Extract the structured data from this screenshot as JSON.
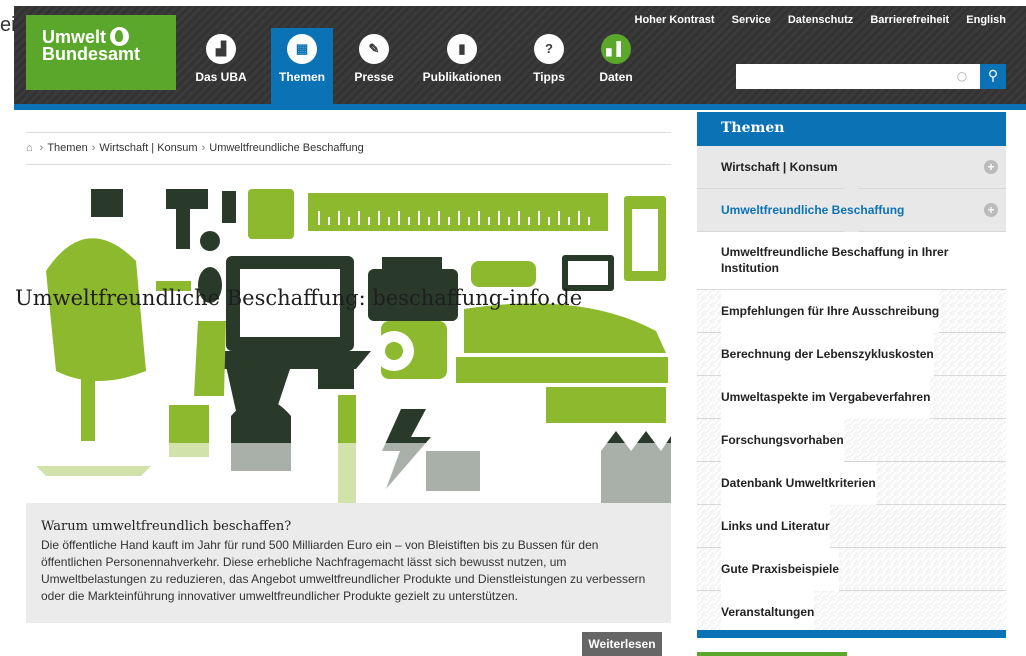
{
  "stray_text": "ei",
  "logo": {
    "line1": "Umwelt",
    "line2": "Bundesamt"
  },
  "top_links": [
    "Hoher Kontrast",
    "Service",
    "Datenschutz",
    "Barrierefreiheit",
    "English"
  ],
  "nav": [
    {
      "label": "Das UBA",
      "icon": "building-icon",
      "active": false
    },
    {
      "label": "Themen",
      "icon": "grid-icon",
      "active": true
    },
    {
      "label": "Presse",
      "icon": "pencil-icon",
      "active": false
    },
    {
      "label": "Publikationen",
      "icon": "book-icon",
      "active": false
    },
    {
      "label": "Tipps",
      "icon": "lightbulb-icon",
      "active": false
    },
    {
      "label": "Daten",
      "icon": "barchart-icon",
      "active": false
    }
  ],
  "search": {
    "placeholder": "",
    "value": ""
  },
  "breadcrumb": [
    "Themen",
    "Wirtschaft | Konsum",
    "Umweltfreundliche Beschaffung"
  ],
  "hero": {
    "title": "Umweltfreundliche Beschaffung: beschaffung-info.de"
  },
  "teaser": {
    "heading": "Warum umweltfreundlich beschaffen?",
    "text": "Die öffentliche Hand kauft im Jahr für rund 500 Milliarden Euro ein – von Bleistiften bis zu Bussen für den öffentlichen Personennahverkehr. Diese erhebliche Nachfragemacht lässt sich bewusst nutzen, um Umweltbelastungen zu reduzieren, das Angebot umweltfreundlicher Produkte und Dienstleistungen zu verbessern oder die Markteinführung innovativer umweltfreundlicher Produkte gezielt zu unterstützen.",
    "more_label": "Weiterlesen"
  },
  "sidebar": {
    "heading": "Themen",
    "items": [
      {
        "label": "Wirtschaft | Konsum",
        "level": 1
      },
      {
        "label": "Umweltfreundliche Beschaffung",
        "level": 2
      },
      {
        "label": "Umweltfreundliche Beschaffung in Ihrer Institution",
        "level": 3
      },
      {
        "label": "Empfehlungen für Ihre Ausschreibung",
        "level": 3
      },
      {
        "label": "Berechnung der Lebenszykluskosten",
        "level": 3
      },
      {
        "label": "Umweltaspekte im Vergabeverfahren",
        "level": 3
      },
      {
        "label": "Forschungsvorhaben",
        "level": 3
      },
      {
        "label": "Datenbank Umweltkriterien",
        "level": 3
      },
      {
        "label": "Links und Literatur",
        "level": 3
      },
      {
        "label": "Gute Praxisbeispiele",
        "level": 3
      },
      {
        "label": "Veranstaltungen",
        "level": 3
      }
    ]
  },
  "colors": {
    "accent_blue": "#0b72b5",
    "logo_green": "#5aa72c",
    "hero_green": "#8db92e"
  }
}
